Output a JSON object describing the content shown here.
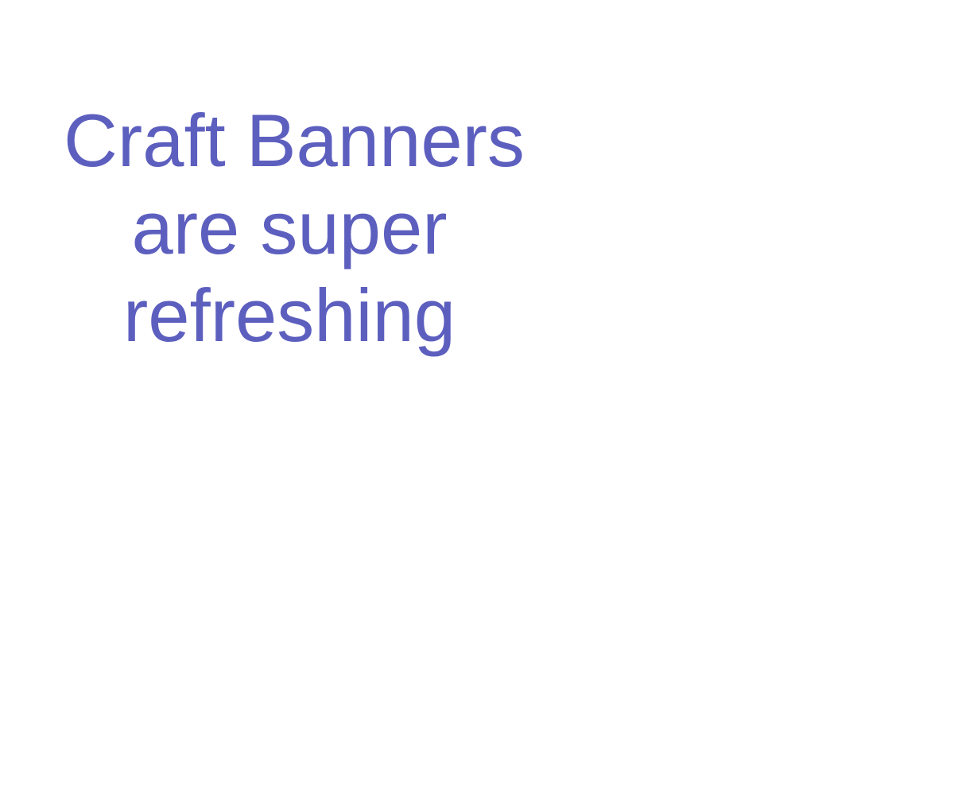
{
  "headline": {
    "lines": [
      "Craft Banners",
      "are super",
      "refreshing"
    ]
  },
  "colors": {
    "text": "#5d5fbf",
    "background": "#ffffff"
  }
}
